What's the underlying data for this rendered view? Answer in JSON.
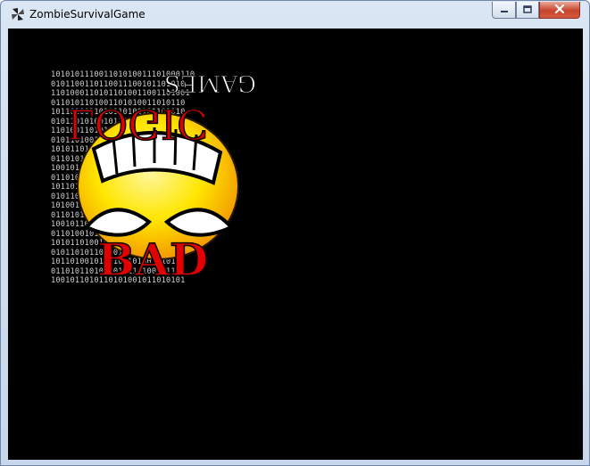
{
  "window": {
    "title": "ZombieSurvivalGame",
    "icon": "pinwheel-app-icon",
    "controls": {
      "minimize": "minimize-icon",
      "maximize": "maximize-icon",
      "close": "close-icon"
    }
  },
  "client_background": "#000000",
  "logo": {
    "text_top": "GAMES",
    "text_middle": "LOGIC",
    "text_bottom": "BAD",
    "text_color": "#e00000",
    "face_color": "#ffe600",
    "binary_pattern": [
      "101010111001101010011101000110",
      "0101100110110011100101101010",
      "11010001101011010011001101001",
      "0110101101001101010011010110",
      "1011010011010110100101101010",
      "0101101010010110101001011010",
      "1101001101011010100110101100",
      "0101101001011010110100101101",
      "1010110100101101011010010110",
      "0110101101010010110100101011",
      "1001011010110101001011010101",
      "0110100101101011010010110101",
      "1011010110100101101001011010",
      "0101101001011010110101001101",
      "1010010110101101001011010100",
      "0110101101001011010110100101",
      "1001011010110100101101011010",
      "0110100101101011010010110101",
      "1010110100101101010010110101",
      "0101101011010010110101001011",
      "1011010010110101101001010110",
      "0110101101001010110100101101",
      "1001011010110101001011010101"
    ]
  }
}
